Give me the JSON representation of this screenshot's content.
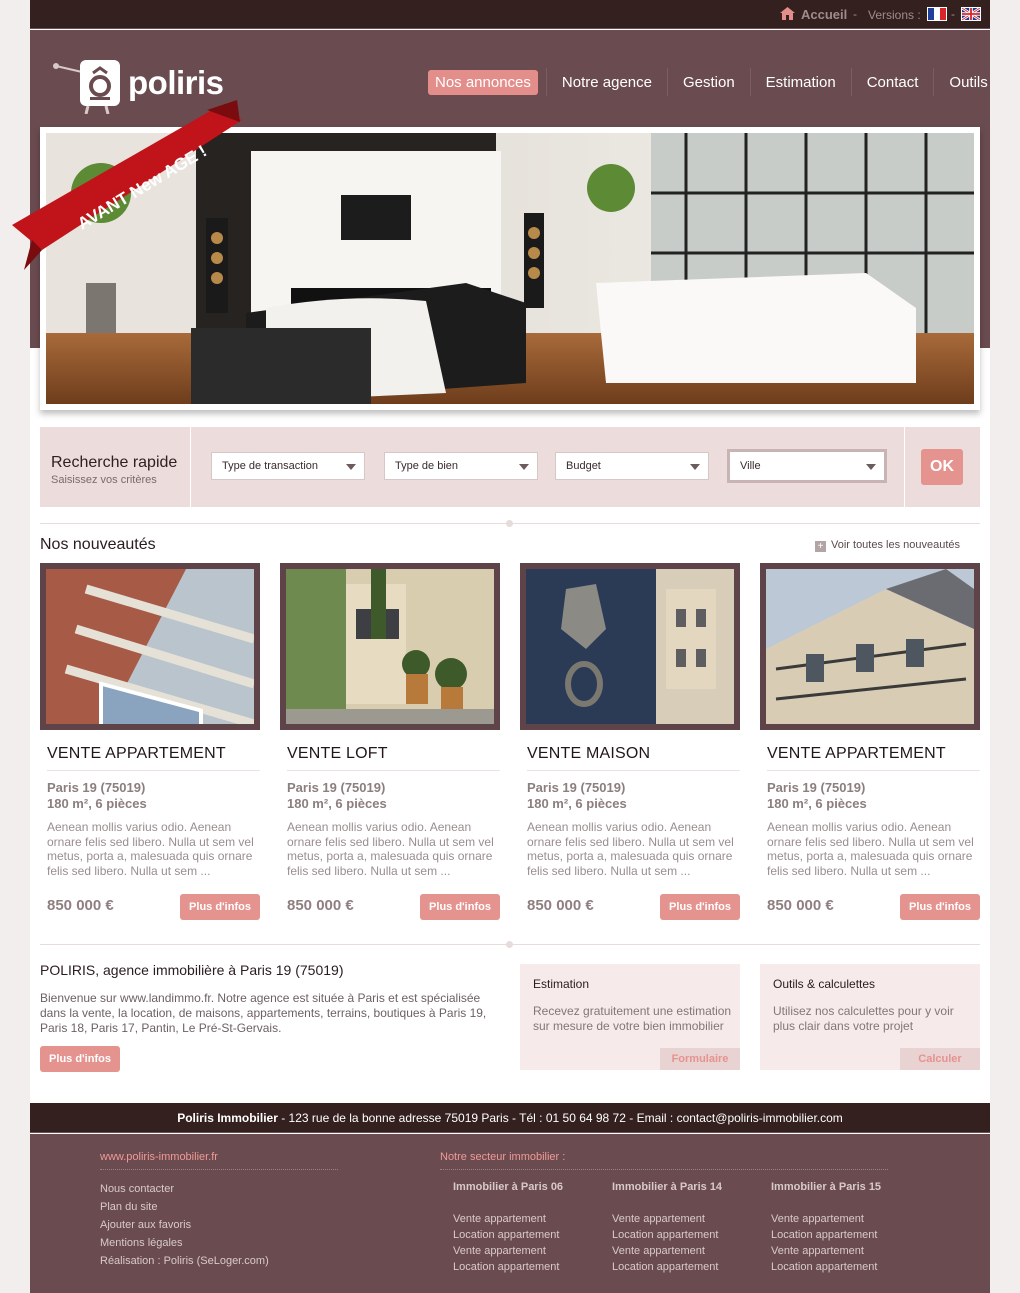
{
  "topbar": {
    "home_label": "Accueil",
    "separator": "-",
    "versions_label": "Versions :",
    "separator2": "-"
  },
  "logo": {
    "text": "poliris"
  },
  "nav": {
    "items": [
      {
        "label": "Nos annonces",
        "active": true
      },
      {
        "label": "Notre agence"
      },
      {
        "label": "Gestion"
      },
      {
        "label": "Estimation"
      },
      {
        "label": "Contact"
      },
      {
        "label": "Outils"
      }
    ]
  },
  "hero": {
    "ribbon_text": "AVANT New AGE !"
  },
  "search": {
    "title": "Recherche rapide",
    "subtitle": "Saisissez vos critères",
    "fields": [
      "Type de transaction",
      "Type de bien",
      "Budget",
      "Ville"
    ],
    "ok_label": "OK"
  },
  "listings": {
    "title": "Nos nouveautés",
    "see_all": "Voir toutes les nouveautés",
    "items": [
      {
        "title": "VENTE APPARTEMENT",
        "city": "Paris 19 (75019)",
        "size": "180 m², 6 pièces",
        "desc": "Aenean mollis varius odio. Aenean ornare felis sed libero. Nulla ut sem vel metus, porta a, malesuada quis ornare felis sed libero. Nulla ut sem  ...",
        "price": "850 000 €",
        "button": "Plus d'infos"
      },
      {
        "title": "VENTE LOFT",
        "city": "Paris 19 (75019)",
        "size": "180 m², 6 pièces",
        "desc": "Aenean mollis varius odio. Aenean ornare felis sed libero. Nulla ut sem vel metus, porta a, malesuada quis ornare felis sed libero. Nulla ut sem  ...",
        "price": "850 000 €",
        "button": "Plus d'infos"
      },
      {
        "title": "VENTE MAISON",
        "city": "Paris 19 (75019)",
        "size": "180 m², 6 pièces",
        "desc": "Aenean mollis varius odio. Aenean ornare felis sed libero. Nulla ut sem vel metus, porta a, malesuada quis ornare felis sed libero. Nulla ut sem  ...",
        "price": "850 000 €",
        "button": "Plus d'infos"
      },
      {
        "title": "VENTE APPARTEMENT",
        "city": "Paris 19 (75019)",
        "size": "180 m², 6 pièces",
        "desc": "Aenean mollis varius odio. Aenean ornare felis sed libero. Nulla ut sem vel metus, porta a, malesuada quis ornare felis sed libero. Nulla ut sem  ...",
        "price": "850 000 €",
        "button": "Plus d'infos"
      }
    ]
  },
  "agency": {
    "title": "POLIRIS, agence immobilière à Paris 19 (75019)",
    "text": "Bienvenue sur www.landimmo.fr. Notre agence est située à Paris et est spécialisée dans la vente, la location, de maisons, appartements, terrains, boutiques à Paris 19, Paris 18, Paris 17, Pantin, Le Pré-St-Gervais.",
    "button": "Plus d'infos"
  },
  "boxes": [
    {
      "title": "Estimation",
      "text": "Recevez gratuitement une estimation sur mesure de votre bien immobilier",
      "button": "Formulaire"
    },
    {
      "title": "Outils & calculettes",
      "text": "Utilisez nos calculettes pour y voir plus clair dans votre projet",
      "button": "Calculer"
    }
  ],
  "footbar": {
    "company": "Poliris Immobilier",
    "details": " - 123 rue de la bonne adresse 75019 Paris - Tél : 01 50 64 98 72 - Email : contact@poliris-immobilier.com"
  },
  "footer": {
    "site": "www.poliris-immobilier.fr",
    "links": [
      "Nous contacter",
      "Plan du site",
      "Ajouter aux favoris",
      "Mentions légales",
      "Réalisation : Poliris (SeLoger.com)"
    ],
    "sector_title": "Notre secteur immobilier :",
    "columns": [
      {
        "title": "Immobilier à Paris 06",
        "links": [
          "Vente appartement",
          "Location appartement",
          "Vente appartement",
          "Location appartement"
        ]
      },
      {
        "title": "Immobilier à Paris 14",
        "links": [
          "Vente appartement",
          "Location appartement",
          "Vente appartement",
          "Location appartement"
        ]
      },
      {
        "title": "Immobilier à Paris 15",
        "links": [
          "Vente appartement",
          "Location appartement",
          "Vente appartement",
          "Location appartement"
        ]
      }
    ]
  },
  "colors": {
    "accent": "#e5938f",
    "header": "#6a4b50",
    "dark": "#34211f"
  }
}
